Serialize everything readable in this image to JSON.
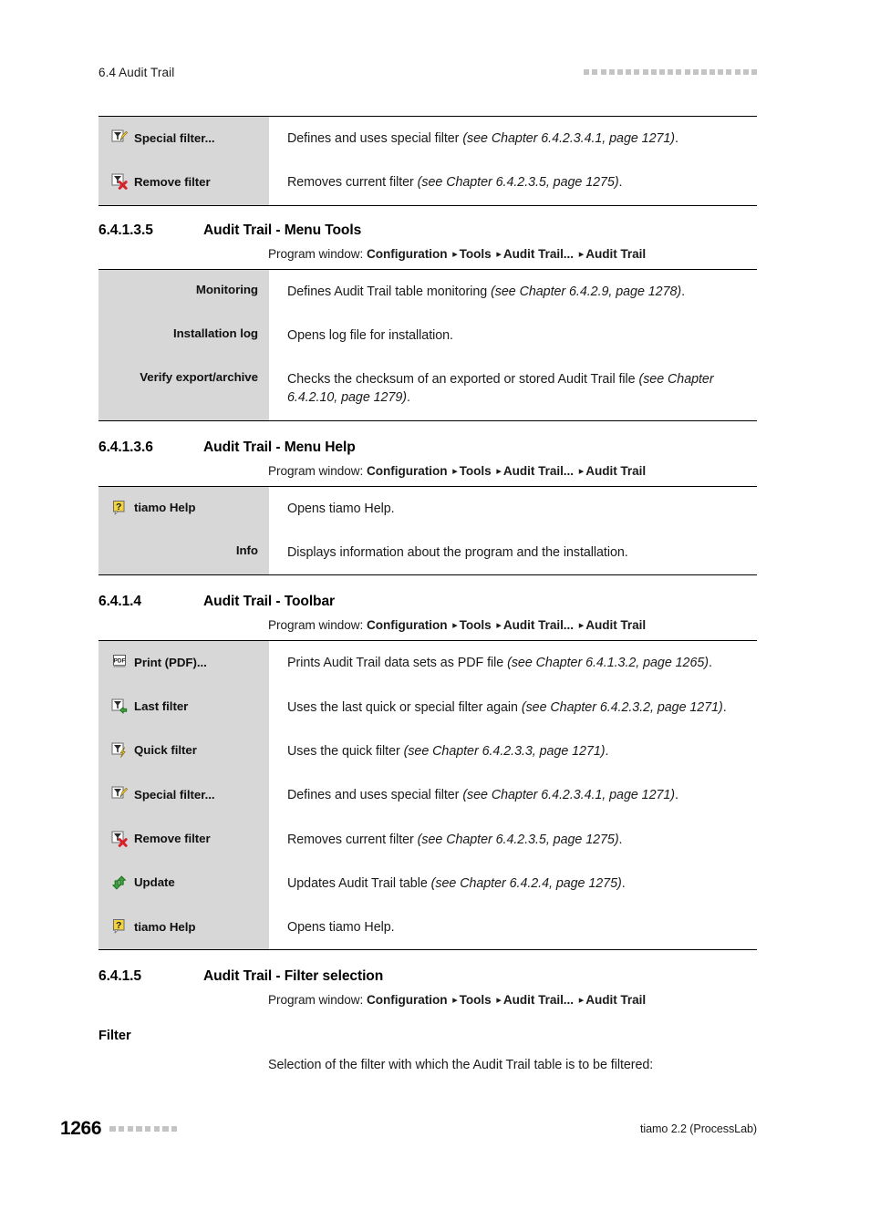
{
  "header": {
    "running_title": "6.4 Audit Trail",
    "dot_count": 21
  },
  "footer": {
    "page_number": "1266",
    "dot_count": 8,
    "product": "tiamo 2.2 (ProcessLab)"
  },
  "program_window": {
    "prefix": "Program window:",
    "path": [
      "Configuration",
      "Tools",
      "Audit Trail...",
      "Audit Trail"
    ],
    "separator": "▸"
  },
  "table_top": {
    "rows": [
      {
        "icon": "special-filter-icon",
        "label": "Special filter...",
        "desc_plain": "Defines and uses special filter ",
        "desc_italic": "(see Chapter 6.4.2.3.4.1, page 1271)",
        "desc_tail": "."
      },
      {
        "icon": "remove-filter-icon",
        "label": "Remove filter",
        "desc_plain": "Removes current filter ",
        "desc_italic": "(see Chapter 6.4.2.3.5, page 1275)",
        "desc_tail": "."
      }
    ]
  },
  "section_menu_tools": {
    "number": "6.4.1.3.5",
    "title": "Audit Trail - Menu Tools",
    "rows": [
      {
        "label": "Monitoring",
        "desc_plain": "Defines Audit Trail table monitoring ",
        "desc_italic": "(see Chapter 6.4.2.9, page 1278)",
        "desc_tail": "."
      },
      {
        "label": "Installation log",
        "desc_plain": "Opens log file for installation.",
        "desc_italic": "",
        "desc_tail": ""
      },
      {
        "label": "Verify export/archive",
        "desc_plain": "Checks the checksum of an exported or stored Audit Trail file ",
        "desc_italic": "(see Chapter 6.4.2.10, page 1279)",
        "desc_tail": "."
      }
    ]
  },
  "section_menu_help": {
    "number": "6.4.1.3.6",
    "title": "Audit Trail - Menu Help",
    "rows": [
      {
        "icon": "tiamo-help-icon",
        "label": "tiamo Help",
        "desc_plain": "Opens tiamo Help.",
        "desc_italic": "",
        "desc_tail": ""
      },
      {
        "icon": "",
        "label": "Info",
        "desc_plain": "Displays information about the program and the installation.",
        "desc_italic": "",
        "desc_tail": ""
      }
    ]
  },
  "section_toolbar": {
    "number": "6.4.1.4",
    "title": "Audit Trail - Toolbar",
    "rows": [
      {
        "icon": "print-pdf-icon",
        "label": "Print (PDF)...",
        "desc_plain": "Prints Audit Trail data sets as PDF file ",
        "desc_italic": "(see Chapter 6.4.1.3.2, page 1265)",
        "desc_tail": "."
      },
      {
        "icon": "last-filter-icon",
        "label": "Last filter",
        "desc_plain": "Uses the last quick or special filter again ",
        "desc_italic": "(see Chapter 6.4.2.3.2, page 1271)",
        "desc_tail": "."
      },
      {
        "icon": "quick-filter-icon",
        "label": "Quick filter",
        "desc_plain": "Uses the quick filter ",
        "desc_italic": "(see Chapter 6.4.2.3.3, page 1271)",
        "desc_tail": "."
      },
      {
        "icon": "special-filter-icon",
        "label": "Special filter...",
        "desc_plain": "Defines and uses special filter ",
        "desc_italic": "(see Chapter 6.4.2.3.4.1, page 1271)",
        "desc_tail": "."
      },
      {
        "icon": "remove-filter-icon",
        "label": "Remove filter",
        "desc_plain": "Removes current filter ",
        "desc_italic": "(see Chapter 6.4.2.3.5, page 1275)",
        "desc_tail": "."
      },
      {
        "icon": "update-icon",
        "label": "Update",
        "desc_plain": "Updates Audit Trail table ",
        "desc_italic": "(see Chapter 6.4.2.4, page 1275)",
        "desc_tail": "."
      },
      {
        "icon": "tiamo-help-icon",
        "label": "tiamo Help",
        "desc_plain": "Opens tiamo Help.",
        "desc_italic": "",
        "desc_tail": ""
      }
    ]
  },
  "section_filter_selection": {
    "number": "6.4.1.5",
    "title": "Audit Trail - Filter selection",
    "filter_label": "Filter",
    "filter_text": "Selection of the filter with which the Audit Trail table is to be filtered:"
  },
  "colors": {
    "label_cell_bg": "#d7d7d7",
    "rule": "#000000",
    "dot": "#c4c4c4",
    "icon_green": "#3aa03a",
    "icon_yellow": "#f4d43c",
    "icon_red": "#d8202a"
  }
}
